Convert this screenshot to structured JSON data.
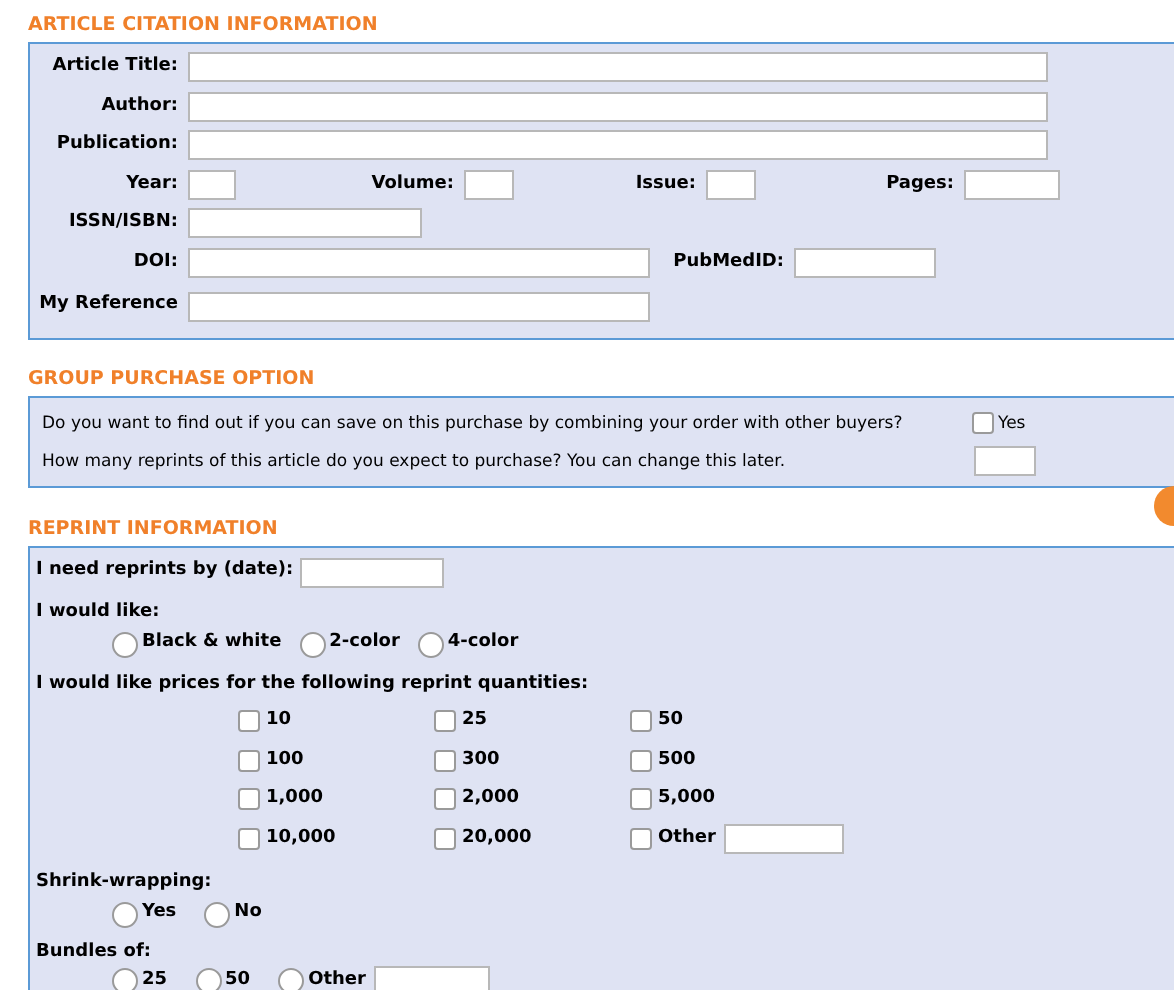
{
  "citation": {
    "heading": "ARTICLE CITATION INFORMATION",
    "rows": [
      [
        "Article Title:"
      ],
      [
        "Author:"
      ],
      [
        "Publication:"
      ],
      [
        "Year:",
        "Volume:",
        "Issue:",
        "Pages:"
      ],
      [
        "ISSN/ISBN:"
      ],
      [
        "DOI:",
        "PubMedID:"
      ],
      [
        "My Reference"
      ]
    ]
  },
  "group": {
    "heading": "GROUP PURCHASE OPTION",
    "question": "Do you want to find out if you can save on this purchase by combining your order with other buyers?",
    "yes_label": "Yes",
    "yes_checked": false,
    "quantity_prompt": "How many reprints of this article do you expect to purchase? You can change this later."
  },
  "reprint": {
    "heading": "REPRINT INFORMATION",
    "date_label": "I need reprints by (date):",
    "color_label": "I would like:",
    "color_options": [
      {
        "label": "Black & white",
        "selected": false
      },
      {
        "label": "2-color",
        "selected": false
      },
      {
        "label": "4-color",
        "selected": false
      }
    ],
    "quantities_label": "I would like prices for the following reprint quantities:",
    "quantities": [
      {
        "label": "10",
        "checked": false
      },
      {
        "label": "25",
        "checked": false
      },
      {
        "label": "50",
        "checked": false
      },
      {
        "label": "100",
        "checked": false
      },
      {
        "label": "300",
        "checked": false
      },
      {
        "label": "500",
        "checked": false
      },
      {
        "label": "1,000",
        "checked": false
      },
      {
        "label": "2,000",
        "checked": false
      },
      {
        "label": "5,000",
        "checked": false
      },
      {
        "label": "10,000",
        "checked": false
      },
      {
        "label": "20,000",
        "checked": false
      },
      {
        "label": "Other",
        "checked": false,
        "kind": "other"
      }
    ],
    "shrink_label": "Shrink-wrapping:",
    "shrink_options": [
      {
        "label": "Yes",
        "selected": false
      },
      {
        "label": "No",
        "selected": false
      }
    ],
    "bundles_label": "Bundles of:",
    "bundle_options": [
      {
        "label": "25",
        "selected": false
      },
      {
        "label": "50",
        "selected": false
      },
      {
        "label": "Other",
        "selected": false,
        "kind": "other"
      }
    ]
  }
}
